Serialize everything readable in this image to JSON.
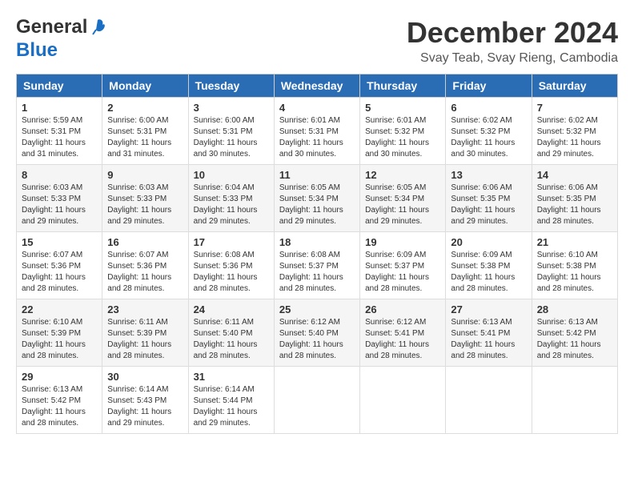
{
  "logo": {
    "line1": "General",
    "line2": "Blue"
  },
  "title": "December 2024",
  "subtitle": "Svay Teab, Svay Rieng, Cambodia",
  "days_of_week": [
    "Sunday",
    "Monday",
    "Tuesday",
    "Wednesday",
    "Thursday",
    "Friday",
    "Saturday"
  ],
  "weeks": [
    [
      {
        "day": "1",
        "sunrise": "Sunrise: 5:59 AM",
        "sunset": "Sunset: 5:31 PM",
        "daylight": "Daylight: 11 hours and 31 minutes."
      },
      {
        "day": "2",
        "sunrise": "Sunrise: 6:00 AM",
        "sunset": "Sunset: 5:31 PM",
        "daylight": "Daylight: 11 hours and 31 minutes."
      },
      {
        "day": "3",
        "sunrise": "Sunrise: 6:00 AM",
        "sunset": "Sunset: 5:31 PM",
        "daylight": "Daylight: 11 hours and 30 minutes."
      },
      {
        "day": "4",
        "sunrise": "Sunrise: 6:01 AM",
        "sunset": "Sunset: 5:31 PM",
        "daylight": "Daylight: 11 hours and 30 minutes."
      },
      {
        "day": "5",
        "sunrise": "Sunrise: 6:01 AM",
        "sunset": "Sunset: 5:32 PM",
        "daylight": "Daylight: 11 hours and 30 minutes."
      },
      {
        "day": "6",
        "sunrise": "Sunrise: 6:02 AM",
        "sunset": "Sunset: 5:32 PM",
        "daylight": "Daylight: 11 hours and 30 minutes."
      },
      {
        "day": "7",
        "sunrise": "Sunrise: 6:02 AM",
        "sunset": "Sunset: 5:32 PM",
        "daylight": "Daylight: 11 hours and 29 minutes."
      }
    ],
    [
      {
        "day": "8",
        "sunrise": "Sunrise: 6:03 AM",
        "sunset": "Sunset: 5:33 PM",
        "daylight": "Daylight: 11 hours and 29 minutes."
      },
      {
        "day": "9",
        "sunrise": "Sunrise: 6:03 AM",
        "sunset": "Sunset: 5:33 PM",
        "daylight": "Daylight: 11 hours and 29 minutes."
      },
      {
        "day": "10",
        "sunrise": "Sunrise: 6:04 AM",
        "sunset": "Sunset: 5:33 PM",
        "daylight": "Daylight: 11 hours and 29 minutes."
      },
      {
        "day": "11",
        "sunrise": "Sunrise: 6:05 AM",
        "sunset": "Sunset: 5:34 PM",
        "daylight": "Daylight: 11 hours and 29 minutes."
      },
      {
        "day": "12",
        "sunrise": "Sunrise: 6:05 AM",
        "sunset": "Sunset: 5:34 PM",
        "daylight": "Daylight: 11 hours and 29 minutes."
      },
      {
        "day": "13",
        "sunrise": "Sunrise: 6:06 AM",
        "sunset": "Sunset: 5:35 PM",
        "daylight": "Daylight: 11 hours and 29 minutes."
      },
      {
        "day": "14",
        "sunrise": "Sunrise: 6:06 AM",
        "sunset": "Sunset: 5:35 PM",
        "daylight": "Daylight: 11 hours and 28 minutes."
      }
    ],
    [
      {
        "day": "15",
        "sunrise": "Sunrise: 6:07 AM",
        "sunset": "Sunset: 5:36 PM",
        "daylight": "Daylight: 11 hours and 28 minutes."
      },
      {
        "day": "16",
        "sunrise": "Sunrise: 6:07 AM",
        "sunset": "Sunset: 5:36 PM",
        "daylight": "Daylight: 11 hours and 28 minutes."
      },
      {
        "day": "17",
        "sunrise": "Sunrise: 6:08 AM",
        "sunset": "Sunset: 5:36 PM",
        "daylight": "Daylight: 11 hours and 28 minutes."
      },
      {
        "day": "18",
        "sunrise": "Sunrise: 6:08 AM",
        "sunset": "Sunset: 5:37 PM",
        "daylight": "Daylight: 11 hours and 28 minutes."
      },
      {
        "day": "19",
        "sunrise": "Sunrise: 6:09 AM",
        "sunset": "Sunset: 5:37 PM",
        "daylight": "Daylight: 11 hours and 28 minutes."
      },
      {
        "day": "20",
        "sunrise": "Sunrise: 6:09 AM",
        "sunset": "Sunset: 5:38 PM",
        "daylight": "Daylight: 11 hours and 28 minutes."
      },
      {
        "day": "21",
        "sunrise": "Sunrise: 6:10 AM",
        "sunset": "Sunset: 5:38 PM",
        "daylight": "Daylight: 11 hours and 28 minutes."
      }
    ],
    [
      {
        "day": "22",
        "sunrise": "Sunrise: 6:10 AM",
        "sunset": "Sunset: 5:39 PM",
        "daylight": "Daylight: 11 hours and 28 minutes."
      },
      {
        "day": "23",
        "sunrise": "Sunrise: 6:11 AM",
        "sunset": "Sunset: 5:39 PM",
        "daylight": "Daylight: 11 hours and 28 minutes."
      },
      {
        "day": "24",
        "sunrise": "Sunrise: 6:11 AM",
        "sunset": "Sunset: 5:40 PM",
        "daylight": "Daylight: 11 hours and 28 minutes."
      },
      {
        "day": "25",
        "sunrise": "Sunrise: 6:12 AM",
        "sunset": "Sunset: 5:40 PM",
        "daylight": "Daylight: 11 hours and 28 minutes."
      },
      {
        "day": "26",
        "sunrise": "Sunrise: 6:12 AM",
        "sunset": "Sunset: 5:41 PM",
        "daylight": "Daylight: 11 hours and 28 minutes."
      },
      {
        "day": "27",
        "sunrise": "Sunrise: 6:13 AM",
        "sunset": "Sunset: 5:41 PM",
        "daylight": "Daylight: 11 hours and 28 minutes."
      },
      {
        "day": "28",
        "sunrise": "Sunrise: 6:13 AM",
        "sunset": "Sunset: 5:42 PM",
        "daylight": "Daylight: 11 hours and 28 minutes."
      }
    ],
    [
      {
        "day": "29",
        "sunrise": "Sunrise: 6:13 AM",
        "sunset": "Sunset: 5:42 PM",
        "daylight": "Daylight: 11 hours and 28 minutes."
      },
      {
        "day": "30",
        "sunrise": "Sunrise: 6:14 AM",
        "sunset": "Sunset: 5:43 PM",
        "daylight": "Daylight: 11 hours and 29 minutes."
      },
      {
        "day": "31",
        "sunrise": "Sunrise: 6:14 AM",
        "sunset": "Sunset: 5:44 PM",
        "daylight": "Daylight: 11 hours and 29 minutes."
      },
      null,
      null,
      null,
      null
    ]
  ]
}
